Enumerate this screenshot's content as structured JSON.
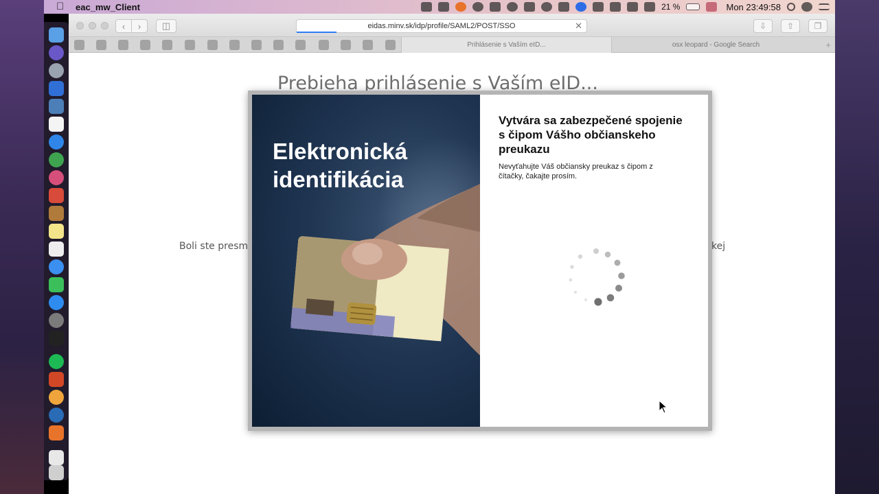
{
  "menubar": {
    "app_name": "eac_mw_Client",
    "battery": "21 %",
    "clock": "Mon 23:49:58"
  },
  "browser": {
    "url": "eidas.minv.sk/idp/profile/SAML2/POST/SSO",
    "tabs": [
      {
        "label": "Prihlásenie s Vaším eID...",
        "active": true
      },
      {
        "label": "osx leopard - Google Search",
        "active": false
      }
    ]
  },
  "page": {
    "heading": "Prebieha prihlásenie s Vaším eID...",
    "bg_text_left": "Boli ste presm",
    "bg_text_right": "kej"
  },
  "dialog": {
    "brand_line1": "Elektronická",
    "brand_line2": "identifikácia",
    "status_title": "Vytvára sa zabezpečené spojenie s čipom Vášho občianskeho preukazu",
    "status_body": "Nevyťahujte Váš občiansky preukaz s čipom z čítačky, čakajte prosím."
  },
  "icons": {
    "menubar_apple": "apple-icon",
    "spinner": "loading-spinner-icon",
    "cursor": "mouse-pointer-icon"
  }
}
